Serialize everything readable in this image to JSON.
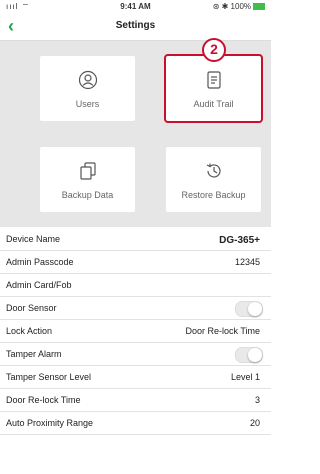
{
  "status_bar": {
    "signal": "ıııl ⌔",
    "time": "9:41 AM",
    "right": "⊛ ✱ 100%"
  },
  "nav": {
    "back_icon": "chevron-left-icon",
    "title": "Settings"
  },
  "annotation": {
    "step_number": "2",
    "color": "#c8102e"
  },
  "tiles": [
    {
      "label": "Users",
      "icon": "user-icon"
    },
    {
      "label": "Audit Trail",
      "icon": "document-list-icon"
    },
    {
      "label": "Backup Data",
      "icon": "backup-document-icon"
    },
    {
      "label": "Restore Backup",
      "icon": "history-clock-icon"
    }
  ],
  "settings": {
    "device_name": {
      "label": "Device Name",
      "value": "DG-365+"
    },
    "admin_passcode": {
      "label": "Admin Passcode",
      "value": "12345"
    },
    "admin_card": {
      "label": "Admin Card/Fob"
    },
    "door_sensor": {
      "label": "Door Sensor",
      "enabled": false
    },
    "lock_action": {
      "label": "Lock Action",
      "value": "Door Re-lock Time"
    },
    "tamper_alarm": {
      "label": "Tamper Alarm",
      "enabled": false
    },
    "tamper_level": {
      "label": "Tamper Sensor Level",
      "value": "Level 1"
    },
    "relock_time": {
      "label": "Door Re-lock Time",
      "value": "3"
    },
    "auto_prox": {
      "label": "Auto Proximity Range",
      "value": "20"
    }
  },
  "colors": {
    "accent": "#1fa44a",
    "highlight": "#c8102e"
  }
}
